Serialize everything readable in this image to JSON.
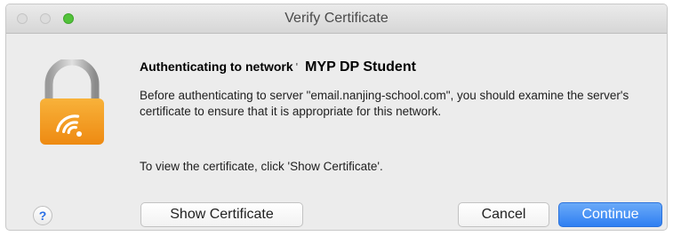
{
  "window": {
    "title": "Verify Certificate"
  },
  "dialog": {
    "heading": "Authenticating to network",
    "heading_tick": "'",
    "network_name": "MYP DP Student",
    "message": "Before authenticating to server \"email.nanjing-school.com\", you should examine the server's certificate to ensure that it is appropriate for this network.",
    "hint": "To view the certificate, click 'Show Certificate'.",
    "icon": "wifi-lock-icon"
  },
  "buttons": {
    "help": "?",
    "show_certificate": "Show Certificate",
    "cancel": "Cancel",
    "continue": "Continue"
  },
  "colors": {
    "accent": "#2f7ff2",
    "lock_body": "#f29a1c",
    "zoom_button": "#52c23a"
  }
}
